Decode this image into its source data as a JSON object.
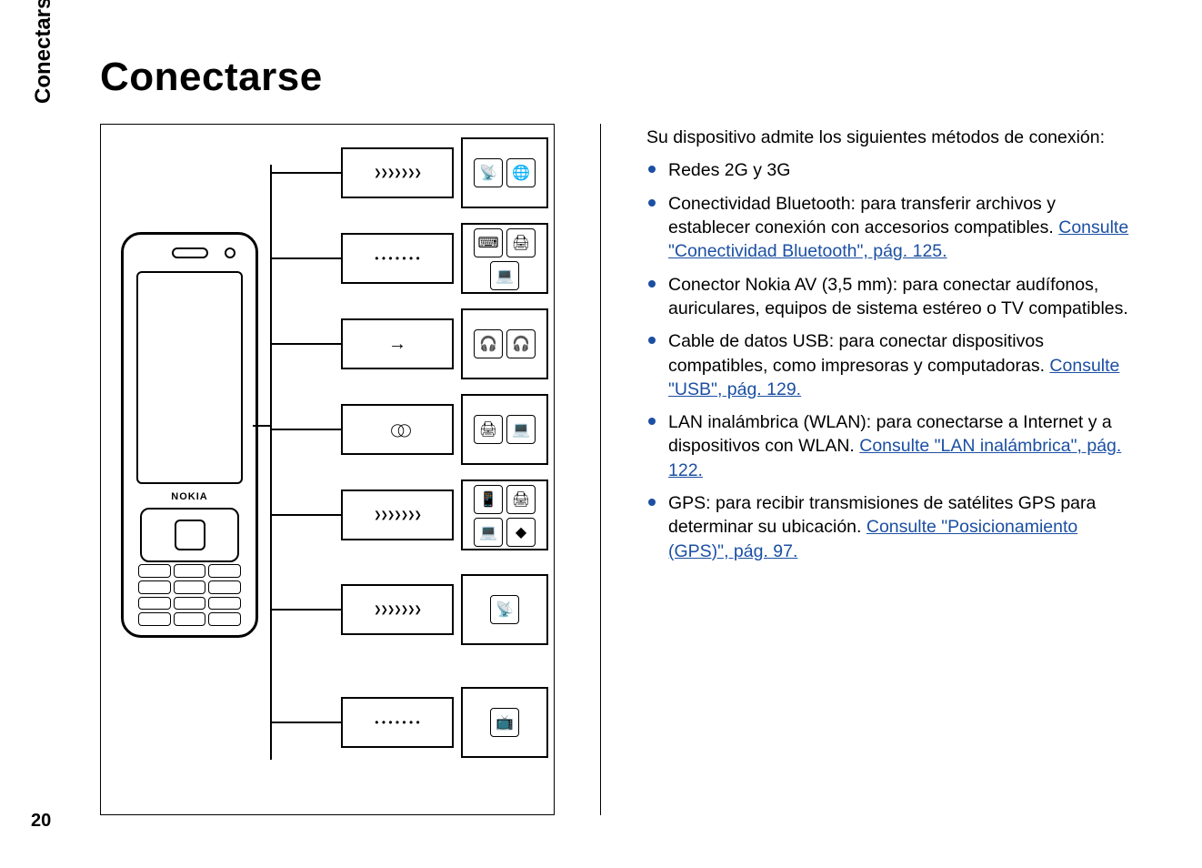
{
  "page": {
    "side_label": "Conectarse",
    "number": "20",
    "title": "Conectarse"
  },
  "phone_brand": "NOKIA",
  "intro": "Su dispositivo admite los siguientes métodos de conexión:",
  "methods": [
    {
      "text": "Redes 2G y 3G",
      "link_label": "",
      "tail": ""
    },
    {
      "text": "Conectividad Bluetooth: para transferir archivos y establecer conexión con accesorios compatibles. ",
      "link_label": "Consulte \"Conectividad Bluetooth\", pág. 125.",
      "tail": ""
    },
    {
      "text": "Conector Nokia AV (3,5 mm): para conectar audífonos, auriculares, equipos de sistema estéreo o TV compatibles.",
      "link_label": "",
      "tail": ""
    },
    {
      "text": "Cable de datos USB: para conectar dispositivos compatibles, como impresoras y computadoras. ",
      "link_label": "Consulte \"USB\", pág. 129.",
      "tail": ""
    },
    {
      "text": "LAN inalámbrica (WLAN): para conectarse a Internet y a dispositivos con WLAN. ",
      "link_label": "Consulte \"LAN inalámbrica\", pág. 122.",
      "tail": ""
    },
    {
      "text": "GPS: para recibir transmisiones de satélites GPS para determinar su ubicación. ",
      "link_label": "Consulte \"Posicionamiento (GPS)\", pág. 97.",
      "tail": ""
    }
  ],
  "diagram_rows": [
    {
      "signal": "waves",
      "icons": [
        "antenna-icon",
        "globe-icon"
      ]
    },
    {
      "signal": "dots",
      "icons": [
        "keyboard-icon",
        "printer-icon",
        "laptop-icon"
      ]
    },
    {
      "signal": "arrow",
      "icons": [
        "earbuds-icon",
        "headphones-icon"
      ]
    },
    {
      "signal": "loop",
      "icons": [
        "printer-icon",
        "laptop-icon"
      ]
    },
    {
      "signal": "waves",
      "icons": [
        "phone-icon",
        "printer-icon",
        "laptop-icon",
        "modem-icon"
      ]
    },
    {
      "signal": "waves",
      "icons": [
        "satellite-dish-icon"
      ]
    },
    {
      "signal": "dots",
      "icons": [
        "tv-cable-icon"
      ]
    }
  ]
}
